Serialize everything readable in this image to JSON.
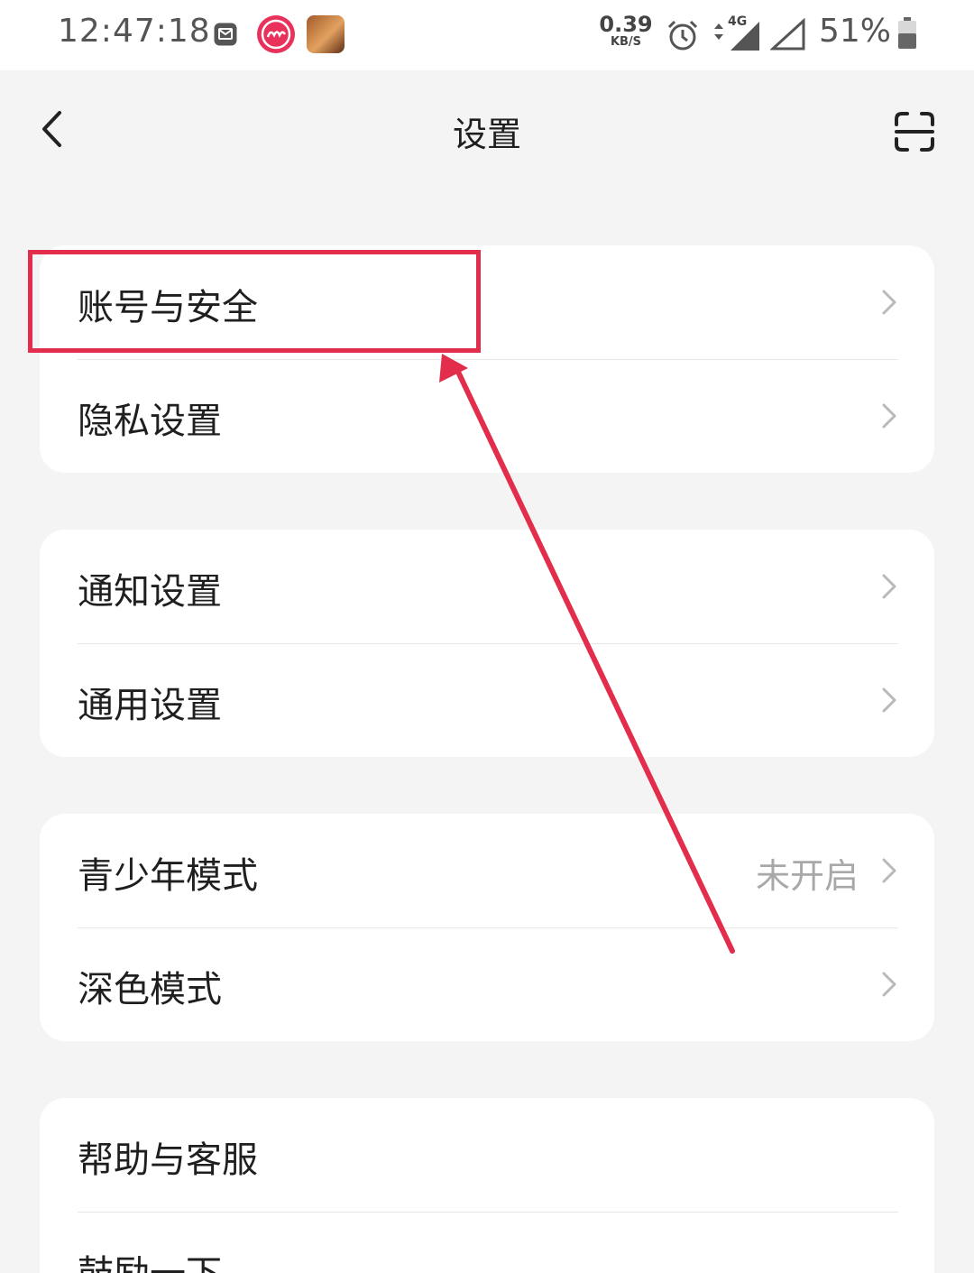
{
  "status_bar": {
    "time": "12:47:18",
    "network_speed": "0.39",
    "network_speed_unit": "KB/S",
    "network_type": "4G",
    "battery": "51%",
    "icons": [
      "mail-icon",
      "app-icon",
      "game-app-icon",
      "alarm-icon",
      "data-arrows-icon",
      "signal-icon",
      "battery-icon"
    ]
  },
  "header": {
    "title": "设置",
    "back_icon": "chevron-left-icon",
    "scan_icon": "scan-icon"
  },
  "sections": [
    {
      "items": [
        {
          "label": "账号与安全"
        },
        {
          "label": "隐私设置"
        }
      ]
    },
    {
      "items": [
        {
          "label": "通知设置"
        },
        {
          "label": "通用设置"
        }
      ]
    },
    {
      "items": [
        {
          "label": "青少年模式",
          "value": "未开启"
        },
        {
          "label": "深色模式"
        }
      ]
    },
    {
      "items": [
        {
          "label": "帮助与客服"
        },
        {
          "label": "鼓励一下"
        }
      ]
    }
  ],
  "annotation": {
    "color": "#e22d4c",
    "highlighted_item": "账号与安全"
  },
  "colors": {
    "background": "#f4f4f4",
    "card": "#ffffff",
    "accent": "#e22d4c",
    "secondary_text": "#a8a8a8"
  }
}
